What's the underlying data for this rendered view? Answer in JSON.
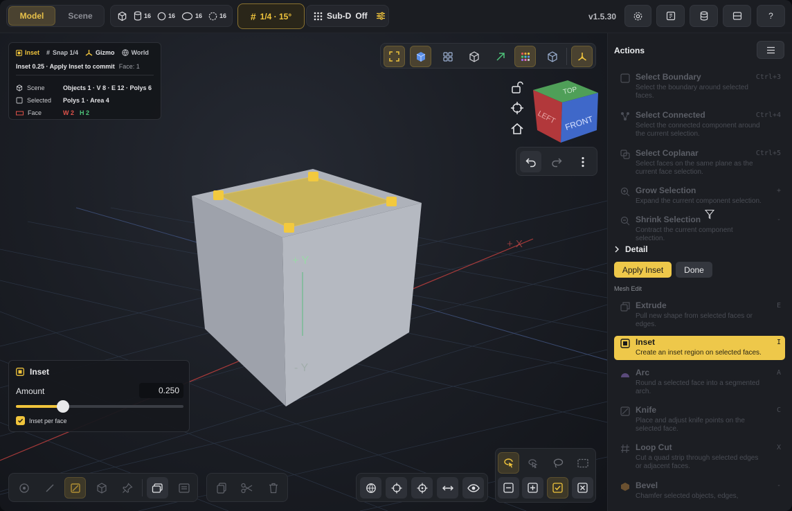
{
  "topbar": {
    "mode_model": "Model",
    "mode_scene": "Scene",
    "primitives": [
      {
        "icon": "cube-icon",
        "count": ""
      },
      {
        "icon": "cylinder-icon",
        "count": "16"
      },
      {
        "icon": "sphere-icon",
        "count": "16"
      },
      {
        "icon": "torus-icon",
        "count": "16"
      },
      {
        "icon": "circle-dashed-icon",
        "count": "16"
      }
    ],
    "snap_label": "1/4 · 15°",
    "subd_label": "Sub-D",
    "subd_state": "Off",
    "version": "v1.5.30",
    "help_label": "?"
  },
  "info": {
    "tags": [
      "Inset",
      "Snap 1/4",
      "Gizmo",
      "World"
    ],
    "message": "Inset 0.25 · Apply Inset to commit",
    "face_label": "Face: 1",
    "rows": [
      {
        "key": "Scene",
        "value": "Objects 1 · V 8 · E 12 · Polys 6"
      },
      {
        "key": "Selected",
        "value": "Polys 1 · Area 4"
      },
      {
        "key": "Face",
        "w": "W 2",
        "h": "H 2"
      }
    ]
  },
  "viewport": {
    "axis_y_pos": "+ Y",
    "axis_y_neg": "- Y",
    "axis_x_pos": "+ X",
    "viewcube": {
      "top": "TOP",
      "left": "LEFT",
      "front": "FRONT"
    }
  },
  "inset_panel": {
    "title": "Inset",
    "amount_label": "Amount",
    "amount_value": "0.250",
    "slider_fraction": 0.28,
    "checkbox_label": "Inset per face",
    "checkbox_checked": true
  },
  "actions_panel": {
    "title": "Actions",
    "items_top": [
      {
        "title": "Select Boundary",
        "desc": "Select the boundary around selected faces.",
        "key": "Ctrl+3",
        "icon": "boundary-icon"
      },
      {
        "title": "Select Connected",
        "desc": "Select the connected component around the current selection.",
        "key": "Ctrl+4",
        "icon": "connected-icon"
      },
      {
        "title": "Select Coplanar",
        "desc": "Select faces on the same plane as the current face selection.",
        "key": "Ctrl+5",
        "icon": "coplanar-icon"
      },
      {
        "title": "Grow Selection",
        "desc": "Expand the current component selection.",
        "key": "+",
        "icon": "grow-icon"
      },
      {
        "title": "Shrink Selection",
        "desc": "Contract the current component selection.",
        "key": "-",
        "icon": "shrink-icon"
      }
    ],
    "detail_label": "Detail",
    "apply_label": "Apply Inset",
    "done_label": "Done",
    "section_label": "Mesh Edit",
    "items_mesh": [
      {
        "title": "Extrude",
        "desc": "Pull new shape from selected faces or edges.",
        "key": "E",
        "icon": "extrude-icon"
      },
      {
        "title": "Inset",
        "desc": "Create an inset region on selected faces.",
        "key": "I",
        "icon": "inset-icon",
        "active": true
      },
      {
        "title": "Arc",
        "desc": "Round a selected face into a segmented arch.",
        "key": "A",
        "icon": "arc-icon"
      },
      {
        "title": "Knife",
        "desc": "Place and adjust knife points on the selected face.",
        "key": "C",
        "icon": "knife-icon"
      },
      {
        "title": "Loop Cut",
        "desc": "Cut a quad strip through selected edges or adjacent faces.",
        "key": "X",
        "icon": "loop-cut-icon"
      },
      {
        "title": "Bevel",
        "desc": "Chamfer selected objects, edges,",
        "key": "-",
        "icon": "bevel-icon"
      }
    ]
  },
  "colors": {
    "accent": "#eec84a",
    "face_highlight": "#c9b45a",
    "cube_gray": "#9ea2ab",
    "w_color": "#e0524a",
    "h_color": "#4ec47a"
  }
}
